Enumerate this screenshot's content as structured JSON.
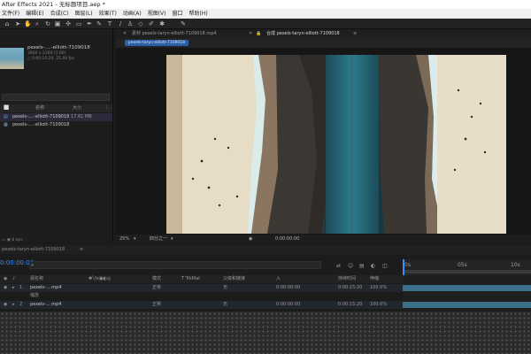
{
  "window": {
    "title": "After Effects 2021 - 无标题项目.aep *"
  },
  "menu": {
    "items": [
      "文件(F)",
      "编辑(E)",
      "合成(C)",
      "图层(L)",
      "效果(T)",
      "动画(A)",
      "视图(V)",
      "窗口",
      "帮助(H)"
    ]
  },
  "project": {
    "item_name": "pexels-....-elliott-7109018",
    "meta_line1": "3840 x 2160 (1.00)",
    "meta_line2": "△ 0:00:15:20, 25.00 fps",
    "columns": {
      "name": "名称",
      "size": "大小"
    },
    "rows": [
      {
        "name": "pexels-....-elliott-7109018",
        "size": "17.61 MB"
      },
      {
        "name": "pexels-....-elliott-7109018",
        "size": ""
      }
    ],
    "footer": "8 bpc"
  },
  "viewer": {
    "tab_footage": "素材 pexels-taryn-elliott-7109018.mp4",
    "tab_comp": "合成 pexels-taryn-elliott-7109018",
    "subtab": "pexels-taryn-elliott-7109018",
    "zoom": "25%",
    "resolution": "四分之一",
    "timecode": "0:00:00:00"
  },
  "timeline": {
    "comp_tab": "pexels-taryn-elliott-7109018",
    "timecode": "0:00:00:00",
    "columns": {
      "name": "源名称",
      "mode": "模式",
      "trkmat": "T TrkMat",
      "parent": "父级和链接",
      "in": "入",
      "duration": "持续时间",
      "stretch": "伸缩"
    },
    "layers": [
      {
        "num": "1",
        "name": "pexels-....mp4",
        "mode": "正常",
        "parent": "无",
        "in": "0:00:00:00",
        "duration": "0:00:15:20",
        "stretch": "100.0%"
      },
      {
        "num": "2",
        "name": "pexels-....mp4",
        "mode": "正常",
        "parent": "无",
        "in": "0:00:00:00",
        "duration": "0:00:15:20",
        "stretch": "100.0%"
      }
    ],
    "sub_row": "缩放",
    "ruler_ticks": [
      "0s",
      "05s",
      "10s"
    ]
  },
  "colors": {
    "accent": "#2d5fa8",
    "timecode": "#3b8cff",
    "track": "#3b6f8a"
  }
}
